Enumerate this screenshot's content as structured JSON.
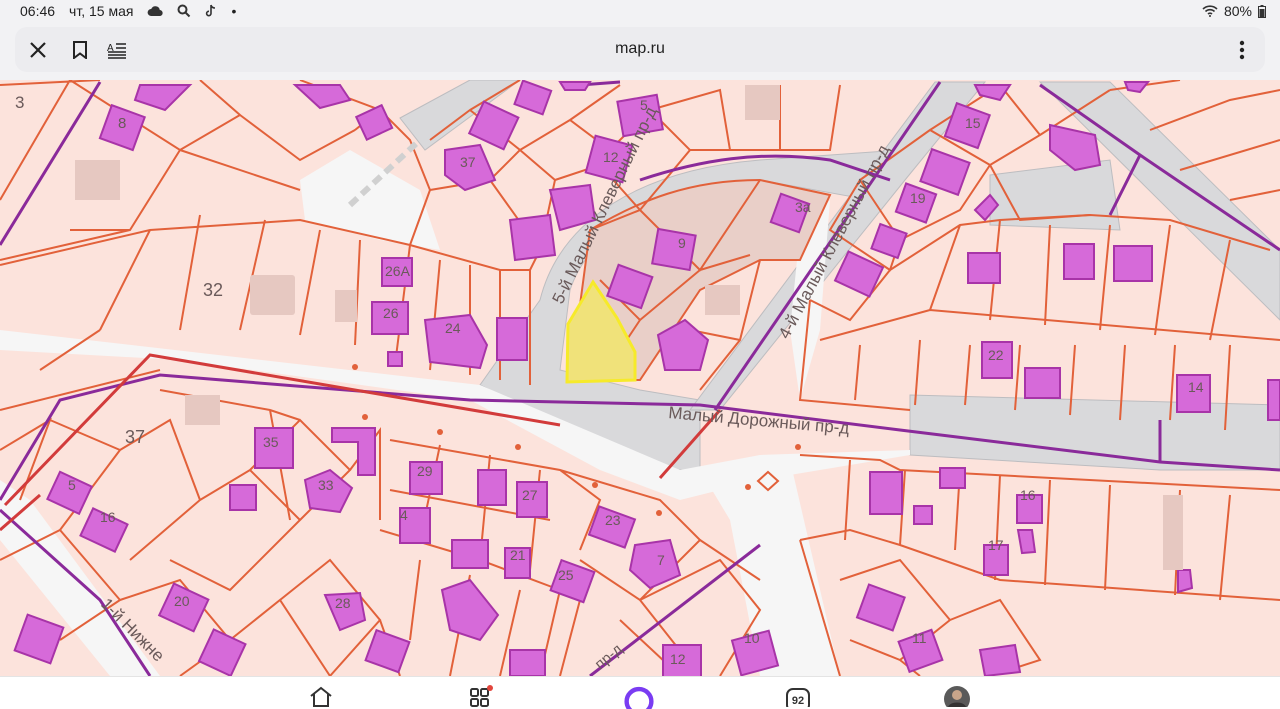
{
  "status_bar": {
    "time": "06:46",
    "date": "чт, 15 мая",
    "dot": "•",
    "battery": "80%"
  },
  "browser": {
    "domain": "map.ru"
  },
  "map": {
    "streets": {
      "maly_klevernyi": "5-й Малый Клеверный пр-д",
      "klevernyi_a": "4-й Малый Клеверный пр-д",
      "dorozhnyi": "Малый Дорожный пр-д",
      "nizhny": "1-й Нижне",
      "pr_a": "пр-д"
    },
    "parcel_labels": {
      "l3": "3",
      "l8": "8",
      "l32": "32",
      "l37": "37",
      "l26a": "26А",
      "l26": "26",
      "l24": "24",
      "l37b": "37",
      "l12": "12",
      "l14": "14",
      "l15": "15",
      "l19": "19",
      "l22": "22",
      "l16": "16",
      "l17": "17",
      "l35": "35",
      "l33": "33",
      "l29": "29",
      "l27": "27",
      "l23": "23",
      "l25": "25",
      "l21": "21",
      "l20": "20",
      "l28": "28",
      "l7": "7",
      "l12b": "12",
      "l10": "10",
      "l11": "11",
      "l9": "9",
      "l5": "5",
      "l3a": "3а",
      "l5b": "5",
      "l4": "4",
      "l16b": "16"
    }
  },
  "icons": {
    "close": "close-icon",
    "bookmark": "bookmark-icon",
    "reader": "reader-mode-icon",
    "menu": "more-icon",
    "home": "home-icon",
    "apps": "apps-icon",
    "alice": "alice-icon",
    "tabs": "tabs-counter-icon",
    "avatar": "avatar"
  },
  "bottom_nav": {
    "tabs_count": "92"
  },
  "colors": {
    "parcel_fill": "#fce3dc",
    "parcel_stroke": "#e2613a",
    "building": "#d66ad9",
    "building_stroke": "#a834a8",
    "road": "#d5d5d7",
    "highlight": "#f0e27a",
    "highlight_stroke": "#f6ea2a",
    "boundary": "#8a2a9a",
    "alice": "#7a3cf2"
  }
}
